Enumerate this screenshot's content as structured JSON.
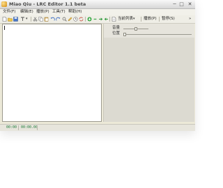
{
  "window": {
    "title": "Miao Qiu - LRC Editor 1.1 beta",
    "controls": {
      "minimize": "─",
      "maximize": "□",
      "close": "✕"
    }
  },
  "menu": [
    {
      "label": "文件(F)"
    },
    {
      "label": "编辑(E)"
    },
    {
      "label": "播放(P)"
    },
    {
      "label": "工具(T)"
    },
    {
      "label": "帮助(H)"
    }
  ],
  "toolbar": {
    "playlist_label": "当前列表",
    "playlist_arrow": "▾",
    "play_label": "播放(P)",
    "pause_label": "暂停(S)",
    "overflow": "»",
    "icons": [
      "new-file-icon",
      "open-folder-icon",
      "save-icon",
      "text-tools-icon",
      "cut-icon",
      "copy-icon",
      "paste-icon",
      "undo-icon",
      "redo-icon",
      "find-icon",
      "edit-icon",
      "timestamp-icon",
      "sync-icon",
      "add-green-icon",
      "remove-icon",
      "arrow-right-icon",
      "arrow-left-icon",
      "document-icon"
    ]
  },
  "editor": {
    "content": ""
  },
  "player": {
    "volume_label": "音量",
    "position_label": "位置",
    "volume_level": 0.5,
    "position_level": 0
  },
  "status": {
    "time1": "00:00",
    "time2": "00:00.00"
  },
  "colors": {
    "window_bg": "#ece9d8",
    "status_text": "#1f7a3a"
  }
}
